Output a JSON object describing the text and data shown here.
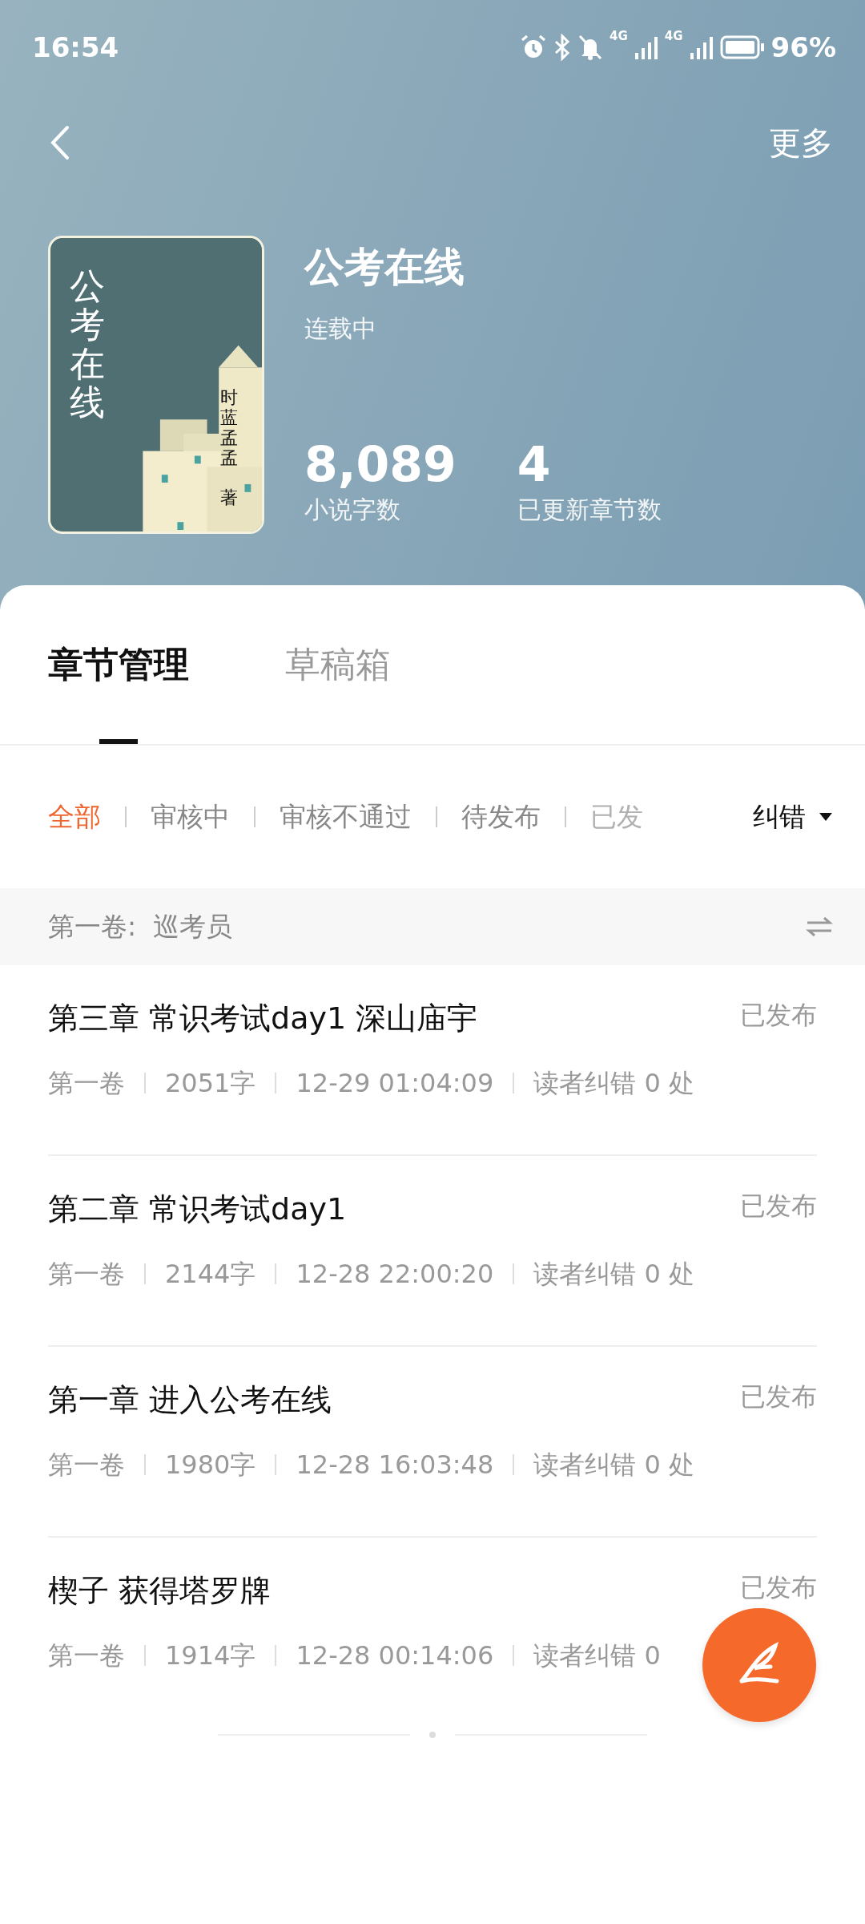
{
  "status_bar": {
    "time": "16:54",
    "battery": "96%",
    "signal_labels": [
      "4G",
      "4G"
    ]
  },
  "header": {
    "more": "更多"
  },
  "book": {
    "cover_title": "公考在线",
    "cover_author": "时蓝孟孟",
    "cover_author_suffix": "著",
    "title": "公考在线",
    "status": "连载中",
    "stats": [
      {
        "value": "8,089",
        "label": "小说字数"
      },
      {
        "value": "4",
        "label": "已更新章节数"
      }
    ]
  },
  "tabs": [
    {
      "label": "章节管理",
      "selected": true
    },
    {
      "label": "草稿箱",
      "selected": false
    }
  ],
  "filters": [
    {
      "label": "全部",
      "selected": true
    },
    {
      "label": "审核中",
      "selected": false
    },
    {
      "label": "审核不通过",
      "selected": false
    },
    {
      "label": "待发布",
      "selected": false
    },
    {
      "label": "已发",
      "selected": false
    }
  ],
  "sort": {
    "label": "纠错"
  },
  "volume": {
    "label": "第一卷:  巡考员"
  },
  "chapters": [
    {
      "title": "第三章 常识考试day1 深山庙宇",
      "status": "已发布",
      "meta": [
        "第一卷",
        "2051字",
        "12-29 01:04:09",
        "读者纠错 0 处"
      ]
    },
    {
      "title": "第二章 常识考试day1",
      "status": "已发布",
      "meta": [
        "第一卷",
        "2144字",
        "12-28 22:00:20",
        "读者纠错 0 处"
      ]
    },
    {
      "title": "第一章 进入公考在线",
      "status": "已发布",
      "meta": [
        "第一卷",
        "1980字",
        "12-28 16:03:48",
        "读者纠错 0 处"
      ]
    },
    {
      "title": "楔子 获得塔罗牌",
      "status": "已发布",
      "meta": [
        "第一卷",
        "1914字",
        "12-28 00:14:06",
        "读者纠错 0"
      ]
    }
  ]
}
